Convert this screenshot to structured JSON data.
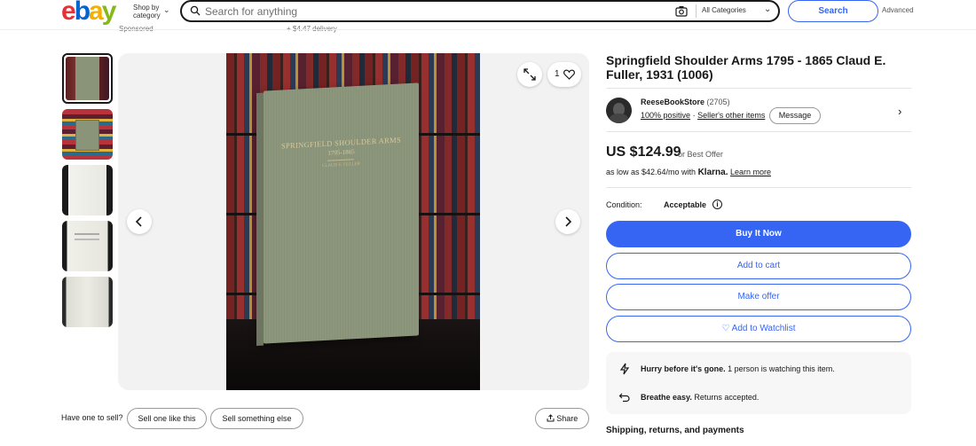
{
  "header": {
    "logo": [
      "e",
      "b",
      "a",
      "y"
    ],
    "shop_by_line1": "Shop by",
    "shop_by_line2": "category",
    "search_placeholder": "Search for anything",
    "category_select": "All Categories",
    "search_button": "Search",
    "advanced_link": "Advanced",
    "sponsored_text": "Sponsored",
    "delivery_text": "+ $4.47 delivery"
  },
  "gallery": {
    "thumbnail_count": 5,
    "selected_index": 0,
    "watch_count": "1",
    "book_cover_title": "SPRINGFIELD SHOULDER ARMS",
    "book_cover_years": "1795-1865",
    "book_cover_author": "CLAUD E. FULLER"
  },
  "sell_bar": {
    "question": "Have one to sell?",
    "sell_like_this": "Sell one like this",
    "sell_something_else": "Sell something else",
    "share": "Share"
  },
  "item": {
    "title": "Springfield Shoulder Arms 1795 - 1865 Claud E. Fuller, 1931 (1006)",
    "seller": {
      "name": "ReeseBookStore",
      "feedback_count": "(2705)",
      "positive": "100% positive",
      "separator": "·",
      "other_items": "Seller's other items",
      "message_button": "Message"
    },
    "price": "US $124.99",
    "best_offer": "or Best Offer",
    "klarna": {
      "prefix": "as low as $42.64/mo with",
      "brand": "Klarna.",
      "learn_more": "Learn more"
    },
    "condition_label": "Condition:",
    "condition_value": "Acceptable",
    "buttons": {
      "buy_now": "Buy It Now",
      "add_to_cart": "Add to cart",
      "make_offer": "Make offer",
      "watchlist": "♡ Add to Watchlist"
    },
    "notices": {
      "hurry_bold": "Hurry before it's gone.",
      "hurry_text": "1 person is watching this item.",
      "returns_bold": "Breathe easy.",
      "returns_text": "Returns accepted."
    },
    "shipping_heading": "Shipping, returns, and payments"
  },
  "colors": {
    "accent_blue": "#3665f3",
    "book_green": "#8a9478"
  }
}
